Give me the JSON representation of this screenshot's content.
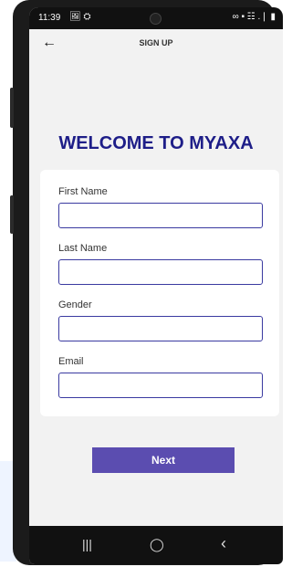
{
  "status": {
    "time": "11:39",
    "left_icons": "🖼 ⛭",
    "right_icons": "∞ ▪ ☷ .❘ ▮"
  },
  "appbar": {
    "title": "SIGN UP",
    "back_icon": "←"
  },
  "welcome": "WELCOME TO MYAXA",
  "form": {
    "fields": [
      {
        "label": "First Name",
        "value": ""
      },
      {
        "label": "Last Name",
        "value": ""
      },
      {
        "label": "Gender",
        "value": ""
      },
      {
        "label": "Email",
        "value": ""
      }
    ]
  },
  "next_label": "Next",
  "navbar": {
    "recents_icon": "|||",
    "home_icon": "◯",
    "back_icon": "‹"
  }
}
